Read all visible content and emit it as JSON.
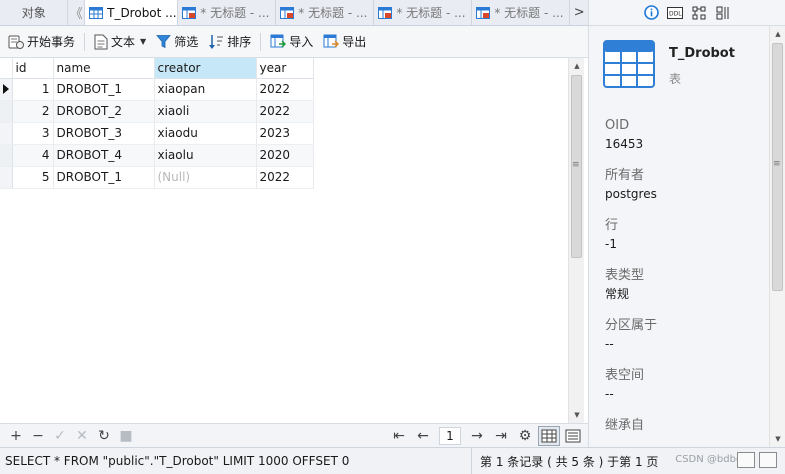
{
  "tabs": {
    "objects_label": "对象",
    "left_arrow": "《",
    "right_arrow": ">",
    "items": [
      {
        "label": "T_Drobot ..."
      },
      {
        "label": "* 无标题 - ..."
      },
      {
        "label": "* 无标题 - ..."
      },
      {
        "label": "* 无标题 - ..."
      },
      {
        "label": "* 无标题 - ..."
      }
    ]
  },
  "right_header": {
    "icons": [
      "info-icon",
      "ddl-icon",
      "structure-icon",
      "split-icon"
    ]
  },
  "toolbar": {
    "begin_transaction": "开始事务",
    "text": "文本",
    "filter": "筛选",
    "sort": "排序",
    "import": "导入",
    "export": "导出"
  },
  "grid": {
    "columns": [
      "id",
      "name",
      "creator",
      "year"
    ],
    "rows": [
      {
        "id": "1",
        "name": "DROBOT_1",
        "creator": "xiaopan",
        "year": "2022"
      },
      {
        "id": "2",
        "name": "DROBOT_2",
        "creator": "xiaoli",
        "year": "2022"
      },
      {
        "id": "3",
        "name": "DROBOT_3",
        "creator": "xiaodu",
        "year": "2023"
      },
      {
        "id": "4",
        "name": "DROBOT_4",
        "creator": "xiaolu",
        "year": "2020"
      },
      {
        "id": "5",
        "name": "DROBOT_1",
        "creator": "(Null)",
        "year": "2022"
      }
    ]
  },
  "nav": {
    "page": "1"
  },
  "status": {
    "sql": "SELECT * FROM \"public\".\"T_Drobot\" LIMIT 1000 OFFSET 0",
    "records": "第 1 条记录 ( 共 5 条 ) 于第 1 页",
    "watermark": "CSDN @bdbdbd"
  },
  "info_panel": {
    "title": "T_Drobot",
    "subtitle": "表",
    "props": [
      {
        "label": "OID",
        "value": "16453"
      },
      {
        "label": "所有者",
        "value": "postgres"
      },
      {
        "label": "行",
        "value": "-1"
      },
      {
        "label": "表类型",
        "value": "常规"
      },
      {
        "label": "分区属于",
        "value": "--"
      },
      {
        "label": "表空间",
        "value": "--"
      },
      {
        "label": "继承自",
        "value": ""
      }
    ]
  },
  "colors": {
    "accent": "#1e78d7",
    "sorted_header": "#c6e7f7",
    "null_text": "#b8b8b8"
  }
}
